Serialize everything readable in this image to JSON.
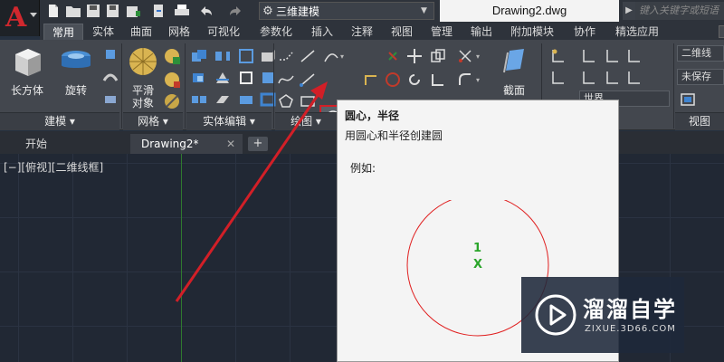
{
  "title_bar": {
    "workspace": "三维建模",
    "document_title": "Drawing2.dwg",
    "search_placeholder": "键入关键字或短语"
  },
  "ribbon_tabs": [
    {
      "label": "常用",
      "active": true
    },
    {
      "label": "实体"
    },
    {
      "label": "曲面"
    },
    {
      "label": "网格"
    },
    {
      "label": "可视化"
    },
    {
      "label": "参数化"
    },
    {
      "label": "插入"
    },
    {
      "label": "注释"
    },
    {
      "label": "视图"
    },
    {
      "label": "管理"
    },
    {
      "label": "输出"
    },
    {
      "label": "附加模块"
    },
    {
      "label": "协作"
    },
    {
      "label": "精选应用"
    }
  ],
  "ribbon": {
    "modeling": {
      "box_label": "长方体",
      "revolve_label": "旋转",
      "footer": "建模"
    },
    "mesh": {
      "smooth_label_1": "平滑",
      "smooth_label_2": "对象",
      "footer": "网格"
    },
    "solid_edit": {
      "footer": "实体编辑"
    },
    "draw": {
      "footer": "绘图"
    },
    "section": {
      "label": "截面"
    },
    "right_panel": {
      "visual_style": "二维线",
      "unsaved": "未保存",
      "world": "世界",
      "footer_view": "视图"
    }
  },
  "doc_tabs": {
    "start": "开始",
    "drawing": "Drawing2*",
    "close_glyph": "✕",
    "new_glyph": "+"
  },
  "canvas": {
    "viewport_label": "[−][俯视][二维线框]"
  },
  "tooltip": {
    "title": "圆心，半径",
    "description": "用圆心和半径创建圆",
    "example_label": "例如:",
    "point_number": "1",
    "point_mark": "X"
  },
  "watermark": {
    "title": "溜溜自学",
    "url": "ZIXUE.3D66.COM"
  },
  "colors": {
    "accent_red": "#d21f27",
    "ribbon_bg": "#43474e",
    "canvas_bg": "#212834",
    "tooltip_bg": "#f4f4f4"
  }
}
